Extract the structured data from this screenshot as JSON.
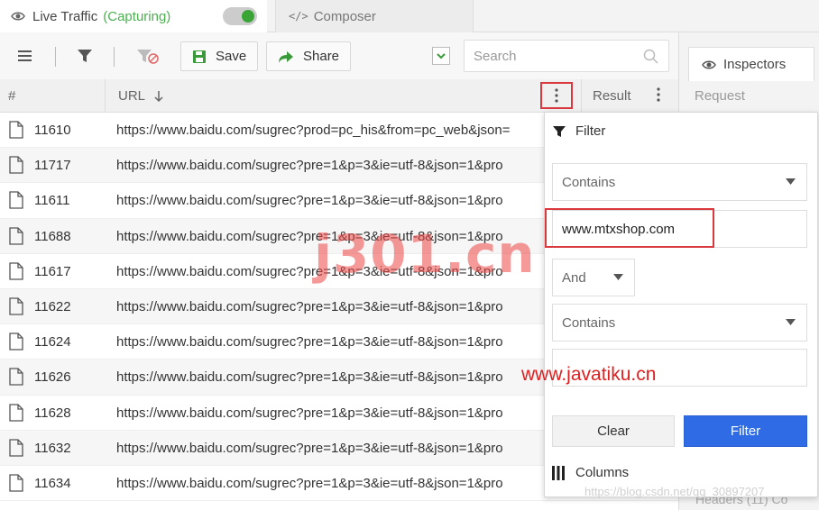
{
  "tabs": {
    "live_traffic": "Live Traffic",
    "capturing": "(Capturing)",
    "composer": "Composer",
    "composer_code": "</>"
  },
  "toolbar": {
    "save_label": "Save",
    "share_label": "Share",
    "search_placeholder": "Search"
  },
  "table": {
    "headers": {
      "num": "#",
      "url": "URL",
      "result": "Result"
    },
    "rows": [
      {
        "num": "11610",
        "url": "https://www.baidu.com/sugrec?prod=pc_his&from=pc_web&json="
      },
      {
        "num": "11717",
        "url": "https://www.baidu.com/sugrec?pre=1&p=3&ie=utf-8&json=1&pro"
      },
      {
        "num": "11611",
        "url": "https://www.baidu.com/sugrec?pre=1&p=3&ie=utf-8&json=1&pro"
      },
      {
        "num": "11688",
        "url": "https://www.baidu.com/sugrec?pre=1&p=3&ie=utf-8&json=1&pro"
      },
      {
        "num": "11617",
        "url": "https://www.baidu.com/sugrec?pre=1&p=3&ie=utf-8&json=1&pro"
      },
      {
        "num": "11622",
        "url": "https://www.baidu.com/sugrec?pre=1&p=3&ie=utf-8&json=1&pro"
      },
      {
        "num": "11624",
        "url": "https://www.baidu.com/sugrec?pre=1&p=3&ie=utf-8&json=1&pro"
      },
      {
        "num": "11626",
        "url": "https://www.baidu.com/sugrec?pre=1&p=3&ie=utf-8&json=1&pro"
      },
      {
        "num": "11628",
        "url": "https://www.baidu.com/sugrec?pre=1&p=3&ie=utf-8&json=1&pro"
      },
      {
        "num": "11632",
        "url": "https://www.baidu.com/sugrec?pre=1&p=3&ie=utf-8&json=1&pro"
      },
      {
        "num": "11634",
        "url": "https://www.baidu.com/sugrec?pre=1&p=3&ie=utf-8&json=1&pro"
      }
    ]
  },
  "inspectors": {
    "tab_label": "Inspectors",
    "request_label": "Request",
    "bottom_text": "Headers (11)   Co"
  },
  "filter_popup": {
    "title": "Filter",
    "condition1": "Contains",
    "value1": "www.mtxshop.com",
    "operator": "And",
    "condition2": "Contains",
    "value2": "",
    "clear_label": "Clear",
    "filter_label": "Filter",
    "columns_label": "Columns"
  },
  "watermarks": {
    "j301": "j301.cn",
    "javatiku": "www.javatiku.cn",
    "csdn": "https://blog.csdn.net/qq_30897207"
  },
  "colors": {
    "accent_blue": "#2f6be5",
    "highlight_red": "#d9393e",
    "capturing_green": "#4caf50",
    "toggle_green": "#3aa537"
  }
}
